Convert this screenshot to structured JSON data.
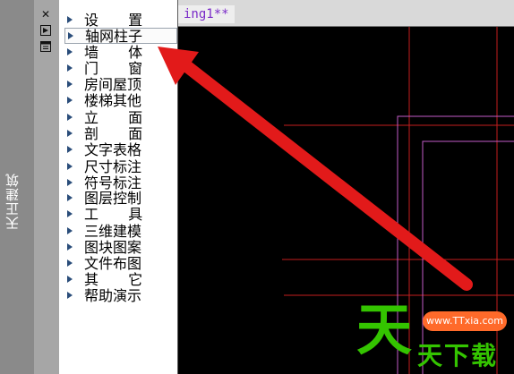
{
  "dock": {
    "title": "天正建筑"
  },
  "toolbar_icons": [
    "close-icon",
    "dock-icon",
    "panel-icon"
  ],
  "menu": {
    "items": [
      {
        "label": "设 置"
      },
      {
        "label": "轴网柱子"
      },
      {
        "label": "墙 体"
      },
      {
        "label": "门 窗"
      },
      {
        "label": "房间屋顶"
      },
      {
        "label": "楼梯其他"
      },
      {
        "label": "立 面"
      },
      {
        "label": "剖 面"
      },
      {
        "label": "文字表格"
      },
      {
        "label": "尺寸标注"
      },
      {
        "label": "符号标注"
      },
      {
        "label": "图层控制"
      },
      {
        "label": "工 具"
      },
      {
        "label": "三维建模"
      },
      {
        "label": "图块图案"
      },
      {
        "label": "文件布图"
      },
      {
        "label": "其 它"
      },
      {
        "label": "帮助演示"
      }
    ]
  },
  "drawing": {
    "tab_label": "ing1**"
  },
  "watermark": {
    "logo": "天",
    "text": "天下载",
    "url": "www.TTxia.com"
  },
  "colors": {
    "grid_line": "#c41e1e",
    "wall_line": "#c25bc9",
    "arrow": "#e21a1a",
    "watermark_green": "#34c400"
  }
}
